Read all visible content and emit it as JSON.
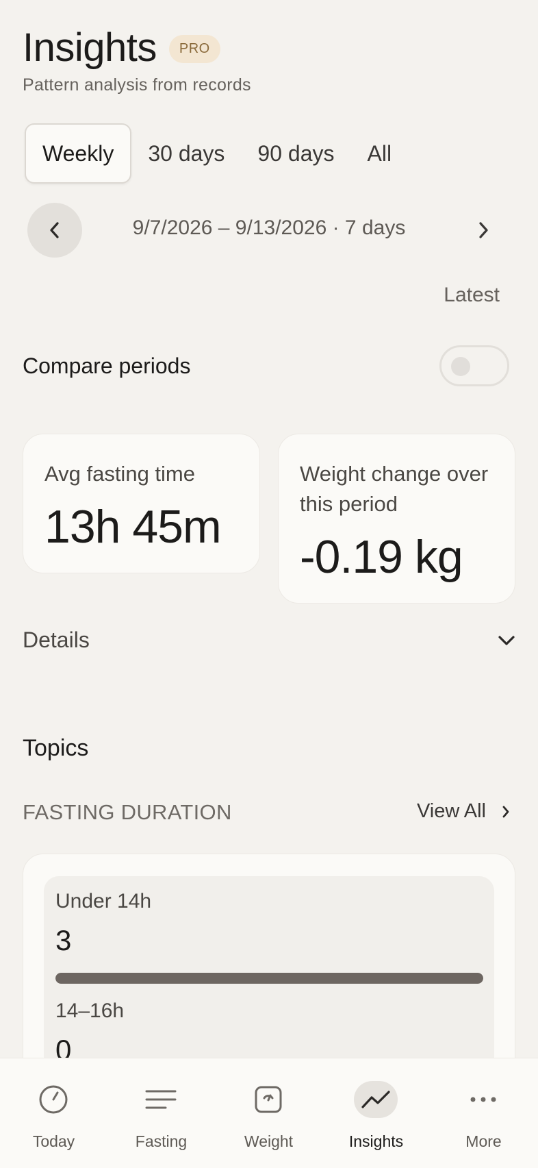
{
  "header": {
    "title": "Insights",
    "badge": "PRO",
    "subtitle": "Pattern analysis from records"
  },
  "tabs": [
    {
      "label": "Weekly",
      "active": true
    },
    {
      "label": "30 days",
      "active": false
    },
    {
      "label": "90 days",
      "active": false
    },
    {
      "label": "All",
      "active": false
    }
  ],
  "date_nav": {
    "range": "9/7/2026 – 9/13/2026 · 7 days",
    "latest_label": "Latest"
  },
  "compare": {
    "label": "Compare periods",
    "enabled": false
  },
  "stats": {
    "avg_fasting": {
      "label": "Avg fasting time",
      "value": "13h 45m"
    },
    "weight_change": {
      "label": "Weight change over this period",
      "value": "-0.19 kg"
    }
  },
  "details": {
    "label": "Details"
  },
  "topics": {
    "heading": "Topics",
    "section": "FASTING DURATION",
    "view_all": "View All",
    "buckets": [
      {
        "label": "Under 14h",
        "value": "3",
        "fill": 1.0
      },
      {
        "label": "14–16h",
        "value": "0",
        "fill": 0.0
      }
    ]
  },
  "bottom_nav": [
    {
      "label": "Today",
      "icon": "clock-icon",
      "active": false
    },
    {
      "label": "Fasting",
      "icon": "lines-icon",
      "active": false
    },
    {
      "label": "Weight",
      "icon": "scale-icon",
      "active": false
    },
    {
      "label": "Insights",
      "icon": "trend-icon",
      "active": true
    },
    {
      "label": "More",
      "icon": "more-dots-icon",
      "active": false
    }
  ],
  "colors": {
    "background": "#f4f2ee",
    "card": "#fbfaf7",
    "badge_bg": "#f3e6d2",
    "badge_text": "#8a6a3b",
    "bar_fill": "#6d6661"
  }
}
